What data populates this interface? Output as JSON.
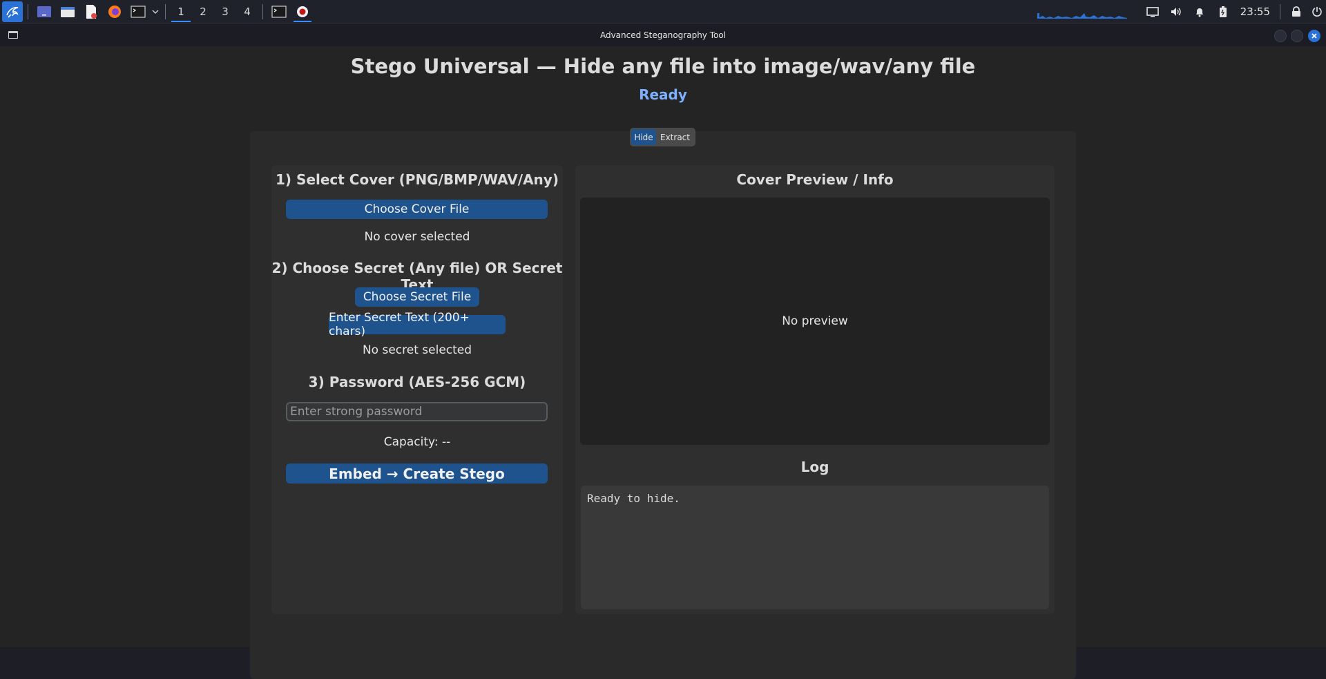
{
  "taskbar": {
    "workspaces": [
      "1",
      "2",
      "3",
      "4"
    ],
    "clock": "23:55",
    "accent": "#3a8cff"
  },
  "window": {
    "title": "Advanced Steganography Tool"
  },
  "app": {
    "title": "Stego Universal — Hide any file into image/wav/any file",
    "status": "Ready",
    "status_color": "#7fb0ff",
    "mode_tabs": [
      "Hide",
      "Extract"
    ],
    "selected_mode": "Hide"
  },
  "left": {
    "step1_heading": "1) Select Cover (PNG/BMP/WAV/Any)",
    "choose_cover_label": "Choose Cover File",
    "cover_status": "No cover selected",
    "step2_heading": "2) Choose Secret (Any file) OR Secret Text",
    "choose_secret_label": "Choose Secret File",
    "enter_text_label": "Enter Secret Text (200+ chars)",
    "secret_status": "No secret selected",
    "step3_heading": "3) Password (AES-256 GCM)",
    "password_placeholder": "Enter strong password",
    "password_value": "",
    "capacity": "Capacity: --",
    "embed_label": "Embed → Create Stego"
  },
  "right": {
    "preview_heading": "Cover Preview / Info",
    "preview_text": "No preview",
    "log_heading": "Log",
    "log_text": "Ready to hide."
  },
  "colors": {
    "button": "#1f538d",
    "panel": "#2f2f2f",
    "background": "#242424"
  }
}
